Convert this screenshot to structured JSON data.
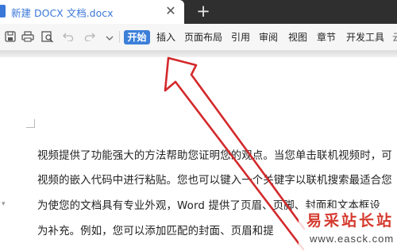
{
  "tab": {
    "title": "新建 DOCX 文档.docx",
    "close_glyph": "✕",
    "add_glyph": "+"
  },
  "toolbar": {
    "icons": [
      "save-icon",
      "print-icon",
      "print-preview-icon",
      "undo-icon",
      "redo-icon",
      "dropdown-icon"
    ],
    "active_tab": "开始",
    "tabs": [
      "插入",
      "页面布局",
      "引用",
      "审阅",
      "视图",
      "章节",
      "开发工具",
      "云"
    ]
  },
  "document": {
    "lines": [
      "视频提供了功能强大的方法帮助您证明您的观点。当您单击联机视频时，可",
      "视频的嵌入代码中进行粘贴。您也可以键入一个关键字以联机搜索最适合您",
      "为使您的文档具有专业外观，Word 提供了页眉、页脚、封面和文本框设",
      "为补充。例如，您可以添加匹配的封面、页眉和提"
    ],
    "side_marker": "▾"
  },
  "watermark": {
    "name": "易采站长站",
    "url": "www.easck.com"
  },
  "colors": {
    "accent": "#3b7fd9",
    "arrow": "#d3292b",
    "watermark": "#d43a2e",
    "tabstrip": "#2f2f30"
  }
}
